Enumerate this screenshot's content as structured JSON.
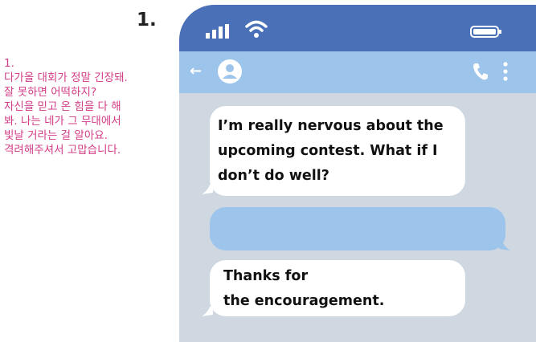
{
  "question_number": "1.",
  "notes_korean": "1.\n다가올 대회가 정말 긴장돼.\n잘 못하면 어떡하지?\n자신을 믿고 온 힘을 다 해\n봐. 나는 네가 그 무대에서\n빛날 거라는 걸 알아요.\n격려해주셔서 고맙습니다.",
  "status_bar": {
    "signal_icon": "signal-bars-icon",
    "wifi_icon": "wifi-icon",
    "battery_icon": "battery-icon"
  },
  "app_bar": {
    "back_icon": "back-arrow-icon",
    "back_glyph": "←",
    "avatar_icon": "avatar-icon",
    "call_icon": "phone-call-icon",
    "menu_icon": "more-vert-icon"
  },
  "messages": [
    {
      "text": "I’m really nervous about the\nupcoming contest. What if I\ndon’t do well?"
    },
    {
      "text": ""
    },
    {
      "text": "Thanks for\nthe encouragement."
    }
  ],
  "colors": {
    "status_bar": "#4a71b8",
    "app_bar": "#9dc4ea",
    "chat_background": "#cfd8e0",
    "notes_text": "#d23c86"
  }
}
